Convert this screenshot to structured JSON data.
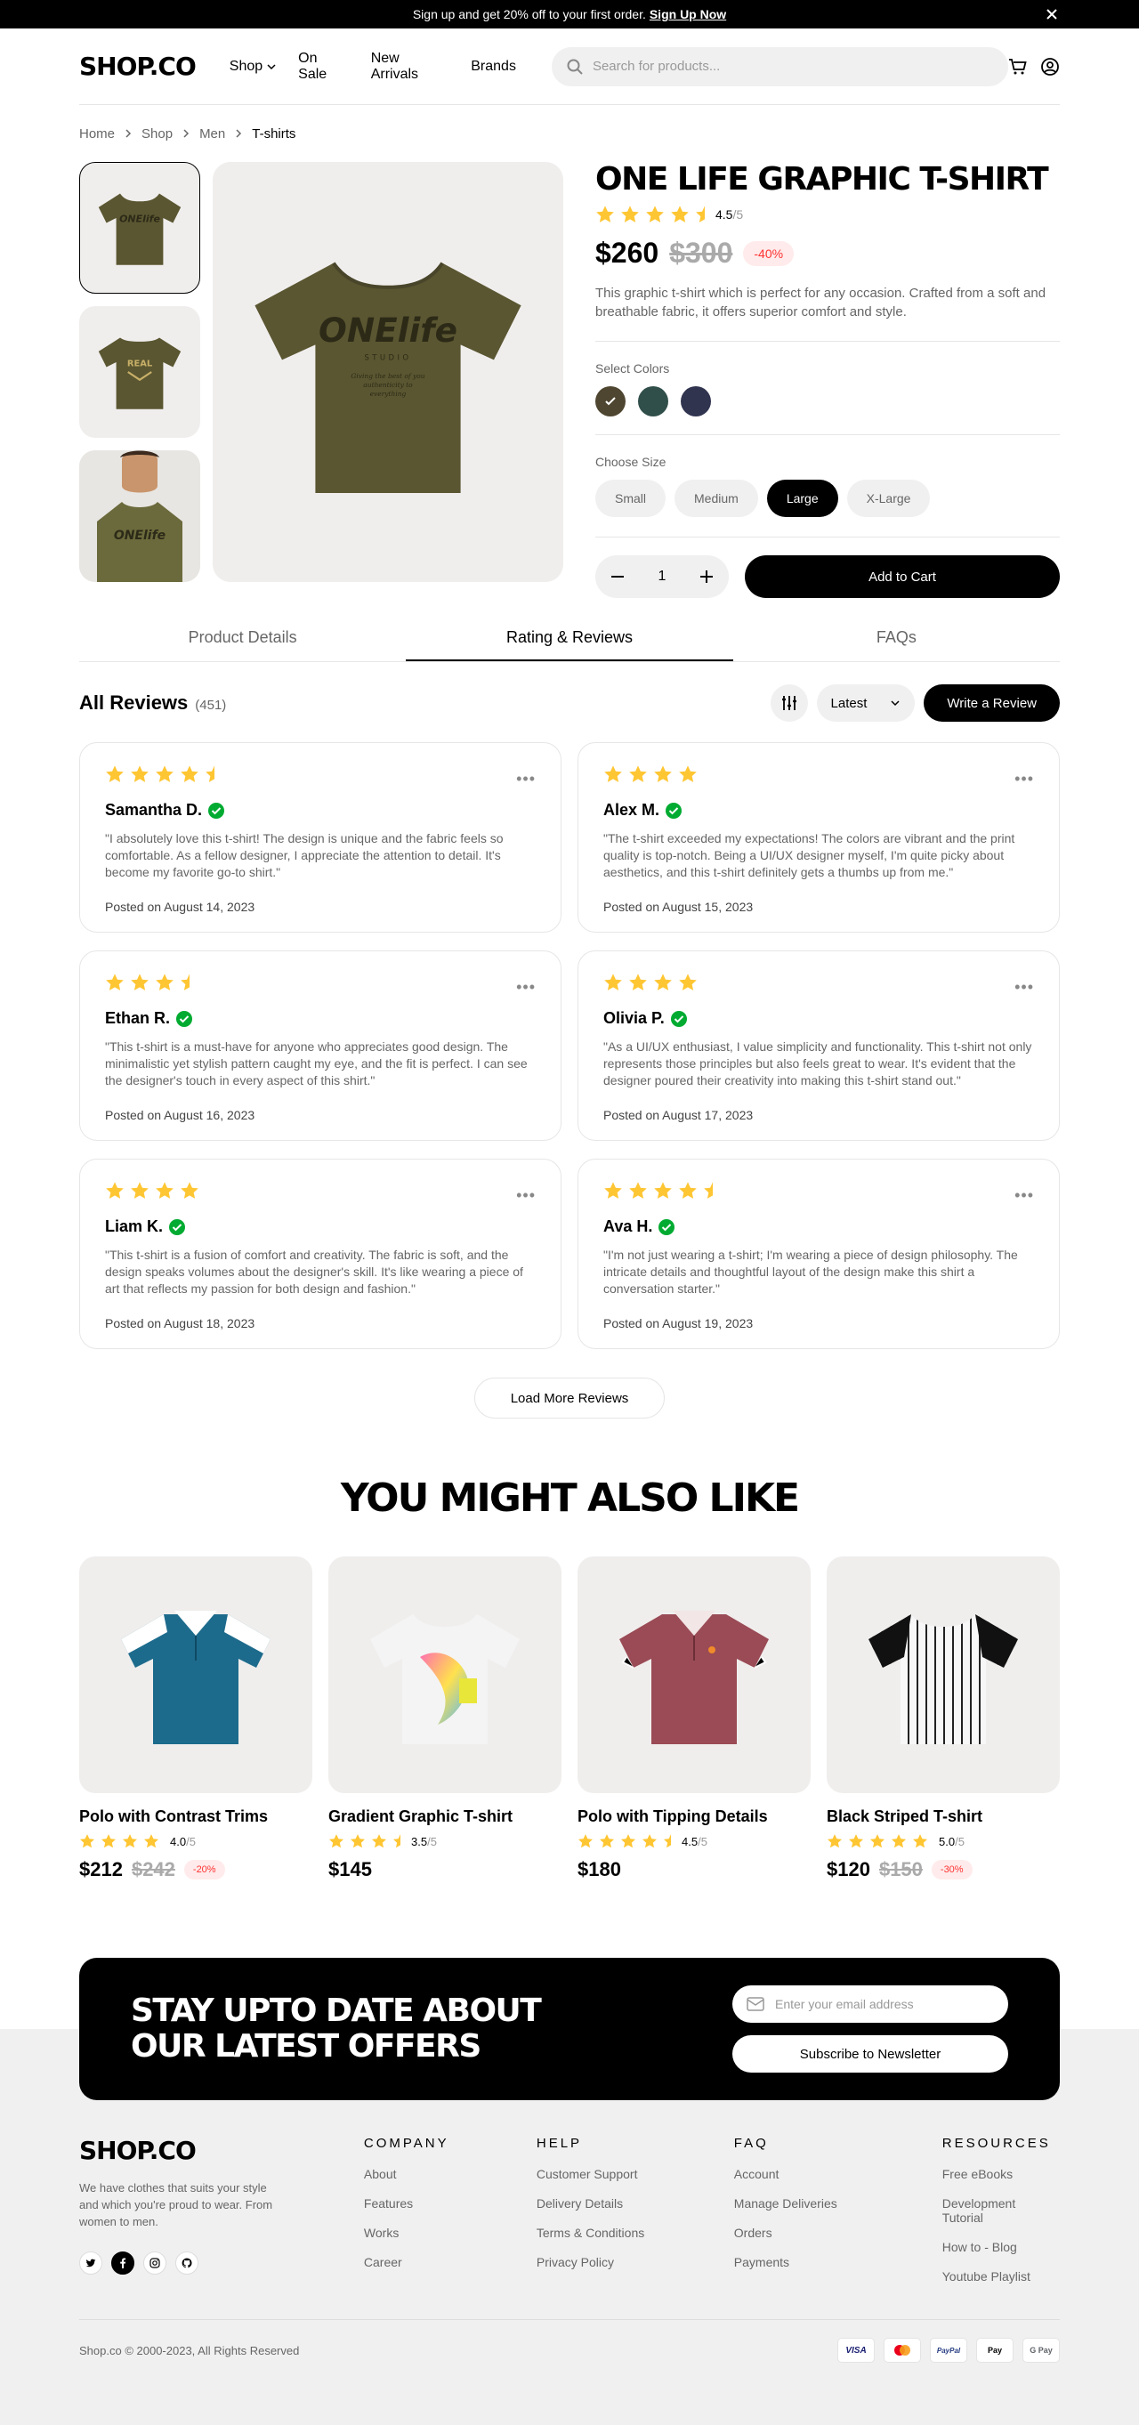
{
  "announcement": {
    "text": "Sign up and get 20% off to your first order.",
    "link": "Sign Up Now"
  },
  "header": {
    "logo": "SHOP.CO",
    "nav": [
      "Shop",
      "On Sale",
      "New Arrivals",
      "Brands"
    ],
    "search_placeholder": "Search for products..."
  },
  "breadcrumb": [
    "Home",
    "Shop",
    "Men",
    "T-shirts"
  ],
  "product": {
    "title": "ONE LIFE GRAPHIC T-SHIRT",
    "rating": 4.5,
    "rating_value": "4.5",
    "rating_max": "/5",
    "price": "$260",
    "old_price": "$300",
    "discount": "-40%",
    "description": "This graphic t-shirt which is perfect for any occasion. Crafted from a soft and breathable fabric, it offers superior comfort and style.",
    "colors_label": "Select Colors",
    "colors": [
      "#4f4631",
      "#314f4a",
      "#31344f"
    ],
    "selected_color": 0,
    "size_label": "Choose Size",
    "sizes": [
      "Small",
      "Medium",
      "Large",
      "X-Large"
    ],
    "selected_size": "Large",
    "quantity": "1",
    "add_to_cart": "Add to Cart"
  },
  "tabs": [
    "Product Details",
    "Rating & Reviews",
    "FAQs"
  ],
  "active_tab": "Rating & Reviews",
  "reviews_section": {
    "title": "All Reviews",
    "count": "(451)",
    "sort": "Latest",
    "write": "Write a Review",
    "load_more": "Load More Reviews"
  },
  "reviews": [
    {
      "name": "Samantha D.",
      "rating": 4.5,
      "text": "\"I absolutely love this t-shirt! The design is unique and the fabric feels so comfortable. As a fellow designer, I appreciate the attention to detail. It's become my favorite go-to shirt.\"",
      "date": "Posted on August 14, 2023"
    },
    {
      "name": "Alex M.",
      "rating": 4,
      "text": "\"The t-shirt exceeded my expectations! The colors are vibrant and the print quality is top-notch. Being a UI/UX designer myself, I'm quite picky about aesthetics, and this t-shirt definitely gets a thumbs up from me.\"",
      "date": "Posted on August 15, 2023"
    },
    {
      "name": "Ethan R.",
      "rating": 3.5,
      "text": "\"This t-shirt is a must-have for anyone who appreciates good design. The minimalistic yet stylish pattern caught my eye, and the fit is perfect. I can see the designer's touch in every aspect of this shirt.\"",
      "date": "Posted on August 16, 2023"
    },
    {
      "name": "Olivia P.",
      "rating": 4,
      "text": "\"As a UI/UX enthusiast, I value simplicity and functionality. This t-shirt not only represents those principles but also feels great to wear. It's evident that the designer poured their creativity into making this t-shirt stand out.\"",
      "date": "Posted on August 17, 2023"
    },
    {
      "name": "Liam K.",
      "rating": 4,
      "text": "\"This t-shirt is a fusion of comfort and creativity. The fabric is soft, and the design speaks volumes about the designer's skill. It's like wearing a piece of art that reflects my passion for both design and fashion.\"",
      "date": "Posted on August 18, 2023"
    },
    {
      "name": "Ava H.",
      "rating": 4.5,
      "text": "\"I'm not just wearing a t-shirt; I'm wearing a piece of design philosophy. The intricate details and thoughtful layout of the design make this shirt a conversation starter.\"",
      "date": "Posted on August 19, 2023"
    }
  ],
  "also_like": {
    "title": "YOU MIGHT ALSO LIKE",
    "products": [
      {
        "name": "Polo with Contrast Trims",
        "rating": 4,
        "rating_value": "4.0",
        "price": "$212",
        "old_price": "$242",
        "discount": "-20%"
      },
      {
        "name": "Gradient Graphic T-shirt",
        "rating": 3.5,
        "rating_value": "3.5",
        "price": "$145",
        "old_price": "",
        "discount": ""
      },
      {
        "name": "Polo with Tipping Details",
        "rating": 4.5,
        "rating_value": "4.5",
        "price": "$180",
        "old_price": "",
        "discount": ""
      },
      {
        "name": "Black Striped T-shirt",
        "rating": 5,
        "rating_value": "5.0",
        "price": "$120",
        "old_price": "$150",
        "discount": "-30%"
      }
    ]
  },
  "newsletter": {
    "title": "STAY UPTO DATE ABOUT OUR LATEST OFFERS",
    "placeholder": "Enter your email address",
    "button": "Subscribe to Newsletter"
  },
  "footer": {
    "logo": "SHOP.CO",
    "tagline": "We have clothes that suits your style and which you're proud to wear. From women to men.",
    "columns": [
      {
        "title": "COMPANY",
        "links": [
          "About",
          "Features",
          "Works",
          "Career"
        ]
      },
      {
        "title": "HELP",
        "links": [
          "Customer Support",
          "Delivery Details",
          "Terms & Conditions",
          "Privacy Policy"
        ]
      },
      {
        "title": "FAQ",
        "links": [
          "Account",
          "Manage Deliveries",
          "Orders",
          "Payments"
        ]
      },
      {
        "title": "RESOURCES",
        "links": [
          "Free eBooks",
          "Development Tutorial",
          "How to - Blog",
          "Youtube Playlist"
        ]
      }
    ],
    "copyright": "Shop.co © 2000-2023, All Rights Reserved",
    "payments": [
      "VISA",
      "Mastercard",
      "PayPal",
      "Apple Pay",
      "G Pay"
    ]
  },
  "colors": {
    "star": "#ffc633",
    "verified": "#01ab31",
    "discount_bg": "#ffebeb",
    "discount_text": "#ff3333",
    "card_bg": "#f0eeed"
  }
}
